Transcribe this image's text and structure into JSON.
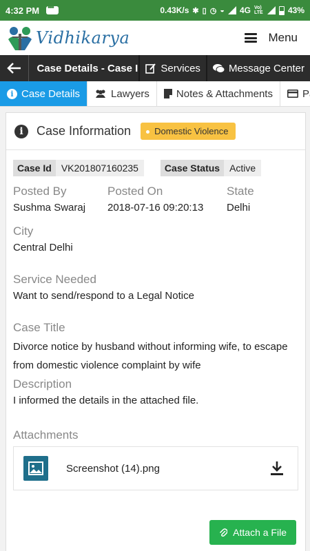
{
  "status_bar": {
    "time": "4:32 PM",
    "speed": "0.43K/s",
    "network": "4G",
    "volte": "Vo) LTE",
    "battery": "43%"
  },
  "app": {
    "brand": "Vidhikarya",
    "menu_label": "Menu"
  },
  "toolbar": {
    "title": "Case Details - Case I...",
    "services": "Services",
    "message_center": "Message Center"
  },
  "tabs": [
    {
      "label": "Case Details",
      "active": true
    },
    {
      "label": "Lawyers"
    },
    {
      "label": "Notes & Attachments"
    },
    {
      "label": "Paym"
    }
  ],
  "case": {
    "header": "Case Information",
    "tag": "Domestic Violence",
    "case_id_label": "Case Id",
    "case_id": "VK201807160235",
    "case_status_label": "Case Status",
    "case_status": "Active",
    "posted_by_label": "Posted By",
    "posted_by": "Sushma Swaraj",
    "posted_on_label": "Posted On",
    "posted_on": "2018-07-16 09:20:13",
    "state_label": "State",
    "state": "Delhi",
    "city_label": "City",
    "city": "Central Delhi",
    "service_label": "Service Needed",
    "service": "Want to send/respond to a Legal Notice",
    "title_label": "Case Title",
    "title": "Divorce notice by husband without informing wife, to escape from domestic violence complaint by wife",
    "description_label": "Description",
    "description": "I informed the details in the attached file."
  },
  "attachments": {
    "label": "Attachments",
    "files": [
      {
        "name": "Screenshot (14).png"
      }
    ],
    "attach_button": "Attach a File"
  },
  "colors": {
    "status_bar": "#3a8b3d",
    "toolbar": "#2c2c2c",
    "active_tab": "#1a9be6",
    "tag": "#f8c242",
    "attach_button": "#27b24f",
    "file_icon": "#1f6f8b"
  }
}
